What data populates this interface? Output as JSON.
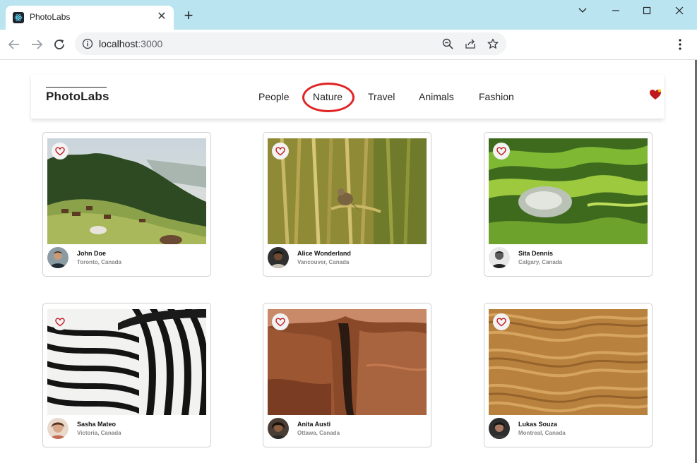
{
  "browser": {
    "tab_title": "PhotoLabs",
    "url_host": "localhost",
    "url_port": ":3000",
    "tab_close": "✕",
    "new_tab": "+"
  },
  "app": {
    "logo": "PhotoLabs",
    "topics": [
      "People",
      "Nature",
      "Travel",
      "Animals",
      "Fashion"
    ],
    "highlighted_topic": "Nature",
    "highlight_color": "#e02424",
    "fav_color": "#c0171c"
  },
  "photos": [
    {
      "name": "John Doe",
      "location": "Toronto, Canada"
    },
    {
      "name": "Alice Wonderland",
      "location": "Vancouver, Canada"
    },
    {
      "name": "Sita Dennis",
      "location": "Calgary, Canada"
    },
    {
      "name": "Sasha Mateo",
      "location": "Victoria, Canada"
    },
    {
      "name": "Anita Austi",
      "location": "Ottawa, Canada"
    },
    {
      "name": "Lukas Souza",
      "location": "Montreal, Canada"
    }
  ]
}
